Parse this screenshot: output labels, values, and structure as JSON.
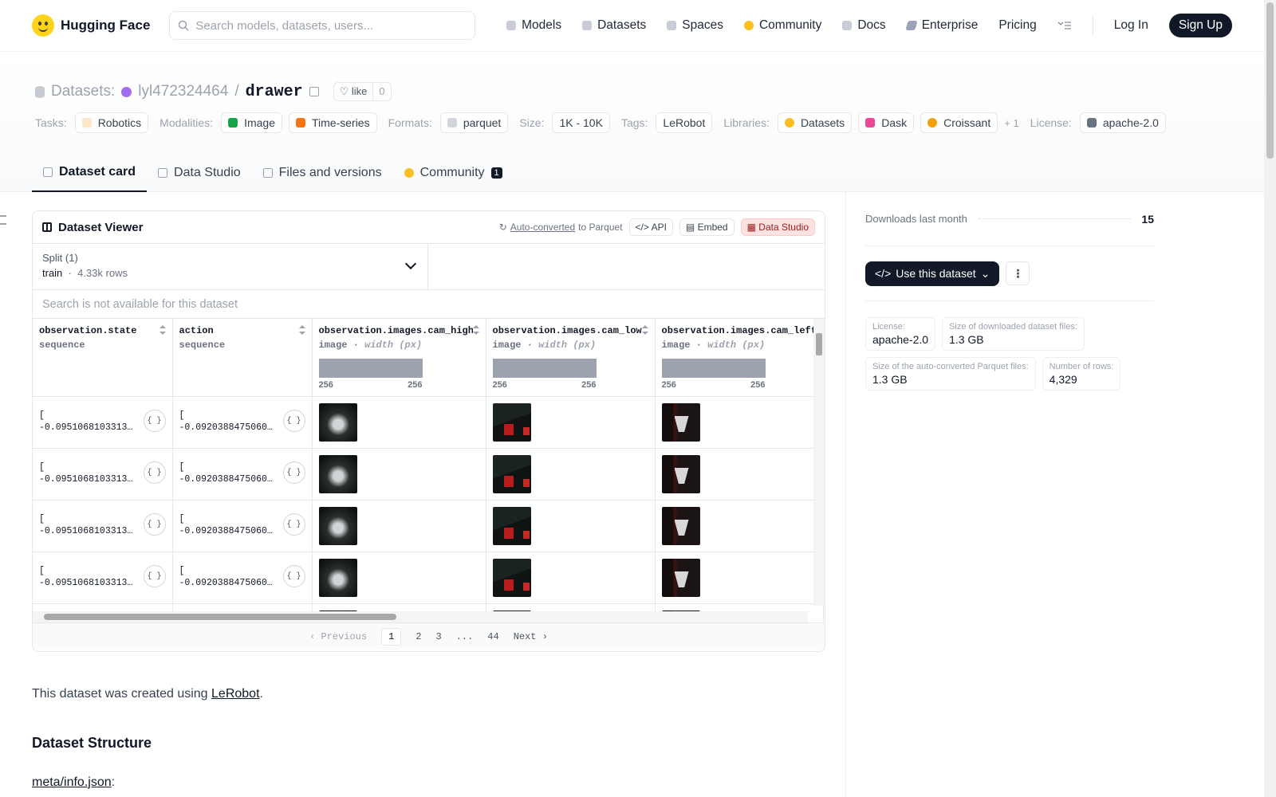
{
  "header": {
    "brand": "Hugging Face",
    "search_placeholder": "Search models, datasets, users...",
    "nav": [
      "Models",
      "Datasets",
      "Spaces",
      "Community",
      "Docs",
      "Enterprise",
      "Pricing"
    ],
    "login": "Log In",
    "signup": "Sign Up"
  },
  "repo": {
    "kind": "Datasets:",
    "owner": "lyl472324464",
    "separator": "/",
    "name": "drawer",
    "like_label": "like",
    "like_count": "0"
  },
  "tags": {
    "tasks_label": "Tasks:",
    "tasks": [
      "Robotics"
    ],
    "modalities_label": "Modalities:",
    "modalities": [
      "Image",
      "Time-series"
    ],
    "formats_label": "Formats:",
    "formats": [
      "parquet"
    ],
    "size_label": "Size:",
    "size": "1K - 10K",
    "tags_label": "Tags:",
    "tags": [
      "LeRobot"
    ],
    "libraries_label": "Libraries:",
    "libraries": [
      "Datasets",
      "Dask",
      "Croissant"
    ],
    "libraries_more": "+ 1",
    "license_label": "License:",
    "license": "apache-2.0"
  },
  "tabs": [
    {
      "label": "Dataset card",
      "active": true
    },
    {
      "label": "Data Studio"
    },
    {
      "label": "Files and versions"
    },
    {
      "label": "Community",
      "badge": "1"
    }
  ],
  "viewer": {
    "title": "Dataset Viewer",
    "auto_converted": "Auto-converted",
    "to_parquet": "to Parquet",
    "api": "API",
    "embed": "Embed",
    "data_studio": "Data Studio",
    "split_label": "Split (1)",
    "split_name": "train",
    "split_rows": "4.33k rows",
    "search_placeholder": "Search is not available for this dataset",
    "columns": [
      {
        "name": "observation.state",
        "type": "sequence"
      },
      {
        "name": "action",
        "type": "sequence"
      },
      {
        "name": "observation.images.cam_high",
        "type": "image",
        "sub": "width (px)",
        "min": "256",
        "max": "256"
      },
      {
        "name": "observation.images.cam_low",
        "type": "image",
        "sub": "width (px)",
        "min": "256",
        "max": "256"
      },
      {
        "name": "observation.images.cam_left",
        "type": "image",
        "sub": "width (px)",
        "min": "256",
        "max": "256"
      }
    ],
    "rows": [
      {
        "state_open": "[",
        "state": "-0.0951068103313…",
        "action_open": "[",
        "action": "-0.0920388475060…"
      },
      {
        "state_open": "[",
        "state": "-0.0951068103313…",
        "action_open": "[",
        "action": "-0.0920388475060…"
      },
      {
        "state_open": "[",
        "state": "-0.0951068103313…",
        "action_open": "[",
        "action": "-0.0920388475060…"
      },
      {
        "state_open": "[",
        "state": "-0.0951068103313…",
        "action_open": "[",
        "action": "-0.0920388475060…"
      }
    ],
    "json_icon": "{ }",
    "pager": {
      "prev": "Previous",
      "pages": [
        "1",
        "2",
        "3",
        "...",
        "44"
      ],
      "next": "Next"
    }
  },
  "card": {
    "intro_prefix": "This dataset was created using ",
    "intro_link": "LeRobot",
    "intro_suffix": ".",
    "section": "Dataset Structure",
    "meta_link": "meta/info.json",
    "meta_suffix": ":"
  },
  "sidebar": {
    "downloads_label": "Downloads last month",
    "downloads_value": "15",
    "use_dataset": "Use this dataset",
    "stats": [
      {
        "label": "License:",
        "value": "apache-2.0"
      },
      {
        "label": "Size of downloaded dataset files:",
        "value": "1.3 GB"
      },
      {
        "label": "Size of the auto-converted Parquet files:",
        "value": "1.3 GB"
      },
      {
        "label": "Number of rows:",
        "value": "4,329"
      }
    ]
  },
  "colors": {
    "brand_yellow": "#ffd21e",
    "dark": "#111827",
    "muted": "#9ca3af"
  }
}
